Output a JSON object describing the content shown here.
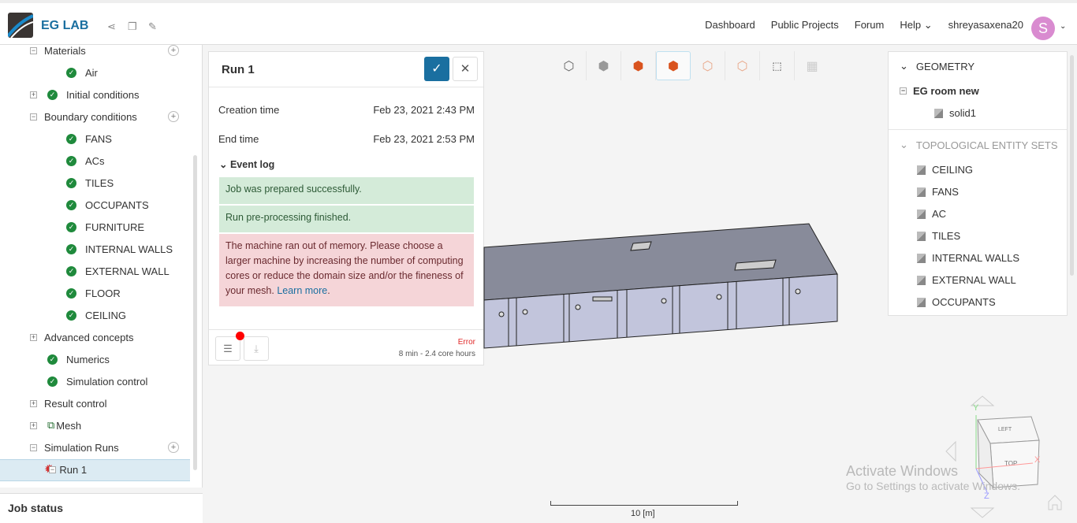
{
  "header": {
    "brand": "EG LAB",
    "nav": [
      "Dashboard",
      "Public Projects",
      "Forum",
      "Help"
    ],
    "username": "shreyasaxena20",
    "avatar_letter": "S"
  },
  "tree": {
    "items": [
      {
        "label": "Materials"
      },
      {
        "label": "Air"
      },
      {
        "label": "Initial conditions"
      },
      {
        "label": "Boundary conditions"
      },
      {
        "label": "FANS"
      },
      {
        "label": "ACs"
      },
      {
        "label": "TILES"
      },
      {
        "label": "OCCUPANTS"
      },
      {
        "label": "FURNITURE"
      },
      {
        "label": "INTERNAL WALLS"
      },
      {
        "label": "EXTERNAL WALL"
      },
      {
        "label": "FLOOR"
      },
      {
        "label": "CEILING"
      },
      {
        "label": "Advanced concepts"
      },
      {
        "label": "Numerics"
      },
      {
        "label": "Simulation control"
      },
      {
        "label": "Result control"
      },
      {
        "label": "Mesh"
      },
      {
        "label": "Simulation Runs"
      },
      {
        "label": "Run 1"
      }
    ]
  },
  "job_status": "Job status",
  "run": {
    "title": "Run 1",
    "creation_label": "Creation time",
    "creation_value": "Feb 23, 2021 2:43 PM",
    "end_label": "End time",
    "end_value": "Feb 23, 2021 2:53 PM",
    "event_log": "Event log",
    "logs": [
      "Job was prepared successfully.",
      "Run pre-processing finished."
    ],
    "error_msg": "The machine ran out of memory. Please choose a larger machine by increasing the number of computing cores or reduce the domain size and/or the fineness of your mesh.",
    "learn_more": "Learn more",
    "status": "Error",
    "usage": "8 min - 2.4 core hours"
  },
  "geometry": {
    "header": "GEOMETRY",
    "root": "EG room new",
    "solid": "solid1",
    "sets_header": "TOPOLOGICAL ENTITY SETS",
    "sets": [
      "CEILING",
      "FANS",
      "AC",
      "TILES",
      "INTERNAL WALLS",
      "EXTERNAL WALL",
      "OCCUPANTS"
    ]
  },
  "viewer": {
    "scale_label": "10 [m]",
    "cube": {
      "left": "LEFT",
      "top": "TOP",
      "x": "X",
      "y": "Y",
      "z": "Z"
    }
  },
  "watermark": {
    "title": "Activate Windows",
    "sub": "Go to Settings to activate Windows."
  },
  "colors": {
    "accent": "#1a6fa0",
    "success": "#1f8a3c",
    "error": "#e02b2b"
  }
}
